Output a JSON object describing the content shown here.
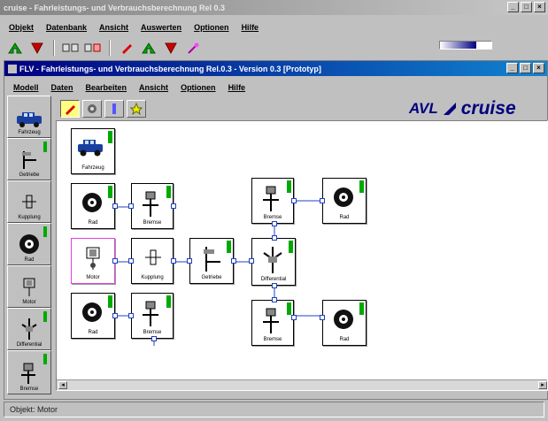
{
  "outer_window": {
    "title": "cruise - Fahrleistungs- und Verbrauchsberechnung Rel 0.3",
    "menu": [
      "Objekt",
      "Datenbank",
      "Ansicht",
      "Auswerten",
      "Optionen",
      "Hilfe"
    ]
  },
  "inner_window": {
    "title": "FLV - Fahrleistungs- und Verbrauchsberechnung Rel.0.3 - Version 0.3 [Prototyp]",
    "menu": [
      "Modell",
      "Daten",
      "Bearbeiten",
      "Ansicht",
      "Optionen",
      "Hilfe"
    ]
  },
  "brand": {
    "logo_text_1": "AVL",
    "logo_text_2": "cruise"
  },
  "palette": [
    {
      "label": "Fahrzeug",
      "icon": "car-icon"
    },
    {
      "label": "Getriebe",
      "icon": "gearbox-icon"
    },
    {
      "label": "Kupplung",
      "icon": "clutch-icon"
    },
    {
      "label": "Rad",
      "icon": "wheel-icon"
    },
    {
      "label": "Motor",
      "icon": "engine-icon"
    },
    {
      "label": "Differential",
      "icon": "differential-icon"
    },
    {
      "label": "Bremse",
      "icon": "brake-icon"
    }
  ],
  "canvas_components": {
    "fahrzeug": "Fahrzeug",
    "rad_tl": "Rad",
    "bremse_tl": "Bremse",
    "motor": "Motor",
    "kupplung": "Kupplung",
    "getriebe": "Getriebe",
    "rad_bl": "Rad",
    "bremse_bl": "Bremse",
    "bremse_tr": "Bremse",
    "rad_tr": "Rad",
    "differential": "Differential",
    "bremse_br": "Bremse",
    "rad_br": "Rad"
  },
  "status": {
    "text": "Objekt: Motor"
  },
  "colors": {
    "accent_green": "#00aa00",
    "connector_blue": "#2040c0",
    "selection_pink": "#e040e0"
  }
}
